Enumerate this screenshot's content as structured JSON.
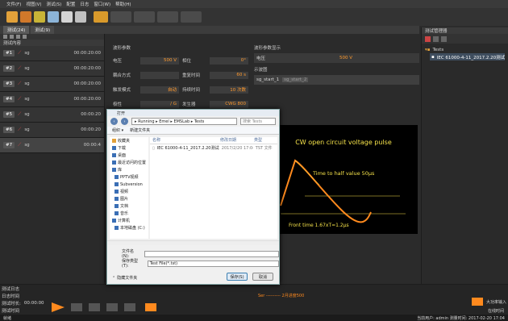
{
  "menu": [
    "文件(F)",
    "视图(V)",
    "测试(S)",
    "配置",
    "日志",
    "窗口(W)",
    "帮助(H)"
  ],
  "tabs": [
    {
      "label": "测试(24)"
    },
    {
      "label": "测试(9)"
    }
  ],
  "left_panel": {
    "header": "测试内容",
    "tests": [
      {
        "idx": "#1",
        "name": "sg",
        "time": "00:00:20:00"
      },
      {
        "idx": "#2",
        "name": "sg",
        "time": "00:00:20:00"
      },
      {
        "idx": "#3",
        "name": "sg",
        "time": "00:00:20:00"
      },
      {
        "idx": "#4",
        "name": "sg",
        "time": "00:00:20:00"
      },
      {
        "idx": "#5",
        "name": "sg",
        "time": "00:00:20"
      },
      {
        "idx": "#6",
        "name": "sg",
        "time": "00:00:20"
      },
      {
        "idx": "#7",
        "name": "sg",
        "time": "00:00:4"
      }
    ]
  },
  "params": {
    "header": "波形参数",
    "rows": [
      {
        "l1": "电压",
        "v1": "500 V",
        "l2": "相位",
        "v2": "0°"
      },
      {
        "l1": "耦合方式",
        "v1": "",
        "l2": "重复时间",
        "v2": "60 s"
      },
      {
        "l1": "触发模式",
        "v1": "自动",
        "l2": "持续时间",
        "v2": "10 次数"
      },
      {
        "l1": "极性",
        "v1": "/ G",
        "l2": "发生器",
        "v2": "CWG 800"
      }
    ]
  },
  "right_top": {
    "header": "波形参数显示",
    "voltage_label": "电压",
    "voltage_value": "500 V",
    "waveform_header": "示波图",
    "waveform_name": "sg_start_1",
    "waveform_hint": "sg_start_2"
  },
  "waveform": {
    "title": "CW open circuit voltage pulse",
    "half_label": "Time to half value 50μs",
    "front_label": "Front time 1.67xT=1.2μs"
  },
  "right_panel": {
    "header": "测试管理器",
    "root": "Tests",
    "item": "IEC 61000-4-11_2017.2.20测试报表测"
  },
  "bottom": {
    "row1": "测试日志",
    "row2": "日志时间",
    "elapsed_label": "测试时长:",
    "elapsed_value": "00:00:00",
    "run_label": "测试时间",
    "progress_text": "Ser ---------- 2月进度500",
    "right1": "大功率输入",
    "right2": "在线时间",
    "status_left": "就绪",
    "status_right": "当前用户: admin  测量时间: 2017-02-20 17:04"
  },
  "dialog": {
    "title": "打开",
    "path": "▸ Running ▸ Emel ▸ EMSLab ▸ Tests",
    "search": "搜索 Tests",
    "cmd_organize": "组织 ▾",
    "cmd_newfolder": "新建文件夹",
    "nav": [
      "收藏夹",
      "下载",
      "桌面",
      "最近访问的位置",
      "库",
      "PPTV视频",
      "Subversion",
      "视频",
      "图片",
      "文档",
      "音乐",
      "计算机",
      "本地磁盘 (C:)"
    ],
    "columns": [
      "名称",
      "修改日期",
      "类型"
    ],
    "files": [
      {
        "name": "IEC 61000-4-11_2017.2.20测试报表tst",
        "date": "2017/2/20 17:04",
        "type": "TST 文件"
      }
    ],
    "filename_label": "文件名(N):",
    "filetype_label": "保存类型(T):",
    "filetype_value": "Test File(*.tst)",
    "hide_folders": "隐藏文件夹",
    "save_button": "保存(S)",
    "cancel_button": "取消"
  }
}
